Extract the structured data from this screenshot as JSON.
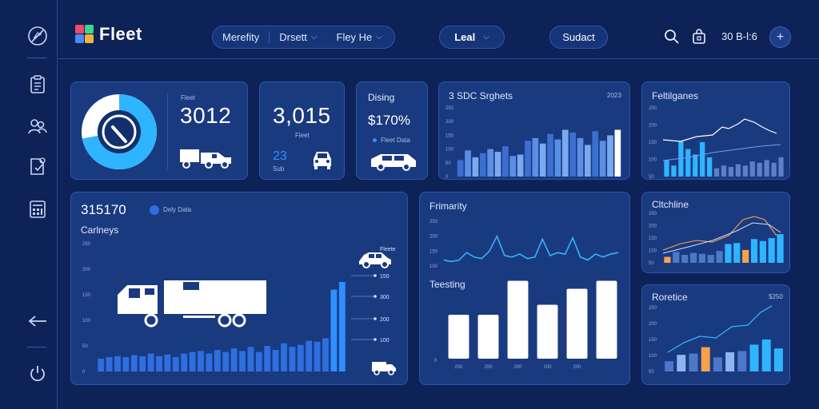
{
  "app": {
    "name": "Fleet",
    "nav": [
      {
        "label": "Merefity"
      },
      {
        "label": "Drsett"
      },
      {
        "label": "Fley He"
      }
    ],
    "filter": {
      "label": "Leal"
    },
    "action": {
      "label": "Sudact"
    },
    "status_text": "30 B-l:6",
    "icons": {
      "sidebar": [
        "compass-icon",
        "clipboard-icon",
        "users-icon",
        "document-icon",
        "calculator-icon",
        "arrow-left-icon",
        "power-icon"
      ],
      "top": [
        "search-icon",
        "bag-icon",
        "plus-icon"
      ]
    },
    "colors": {
      "accent": "#2fb4ff",
      "bar": "#2e8ff0",
      "orange": "#f6a24a"
    }
  },
  "kpi_gauge": {
    "label": "Fleet",
    "value": "3012",
    "gauge_fraction": 0.72
  },
  "kpi_count": {
    "value": "3,015",
    "sub_label": "Fleet",
    "small_value": "23",
    "small_label": "Sub"
  },
  "kpi_rate": {
    "title": "Dising",
    "value": "$170%",
    "legend": "Fleet Data"
  },
  "card_segments": {
    "title": "3 SDC Srghets",
    "corner": "2023",
    "yticks": [
      "250",
      "200",
      "150",
      "100",
      "50",
      "0"
    ]
  },
  "card_fellagenes": {
    "title": "Feltilganes",
    "yticks": [
      "250",
      "200",
      "150",
      "100",
      "50"
    ]
  },
  "card_main": {
    "value": "315170",
    "legend": "Dely Data",
    "subtitle": "Carlneys",
    "yticks": [
      "250",
      "200",
      "150",
      "100",
      "50",
      "0"
    ],
    "right_values": [
      "Fleete",
      "150",
      "300",
      "200",
      "100"
    ]
  },
  "card_frimarity": {
    "title": "Frimarity",
    "yticks": [
      "250",
      "200",
      "150",
      "100"
    ],
    "subtitle": "Teesting",
    "xticks": [
      "200",
      "200",
      "200",
      "200",
      "200"
    ]
  },
  "card_clitchline": {
    "title": "Cltchline",
    "yticks": [
      "250",
      "200",
      "150",
      "100",
      "50"
    ]
  },
  "card_roretice": {
    "title": "Roretice",
    "corner": "$250",
    "yticks": [
      "250",
      "200",
      "150",
      "100",
      "50"
    ]
  },
  "chart_data": [
    {
      "type": "bar",
      "title": "3 SDC Srghets",
      "series": [
        {
          "values": [
            60,
            95,
            70,
            85,
            100,
            90,
            110,
            75,
            80,
            130,
            140,
            120,
            155,
            135,
            170,
            160,
            140,
            115,
            165,
            130,
            150,
            170
          ]
        }
      ],
      "ylim": [
        0,
        250
      ]
    },
    {
      "type": "bar",
      "title": "Feltilganes",
      "series": [
        {
          "values": [
            60,
            40,
            130,
            100,
            80,
            125,
            70,
            30,
            40,
            35,
            45,
            40,
            55,
            50,
            60,
            50,
            70
          ]
        }
      ],
      "ylim": [
        0,
        250
      ]
    },
    {
      "type": "bar",
      "title": "Carlneys",
      "series": [
        {
          "values": [
            25,
            28,
            30,
            28,
            32,
            30,
            35,
            30,
            33,
            28,
            35,
            38,
            40,
            35,
            42,
            38,
            45,
            40,
            48,
            38,
            50,
            42,
            55,
            48,
            52,
            60,
            58,
            65,
            160,
            175
          ]
        }
      ],
      "ylim": [
        0,
        250
      ]
    },
    {
      "type": "line",
      "title": "Frimarity",
      "series": [
        {
          "values": [
            120,
            115,
            120,
            145,
            130,
            125,
            150,
            200,
            135,
            130,
            140,
            125,
            130,
            190,
            135,
            145,
            140,
            195,
            130,
            120,
            140,
            130,
            140,
            145
          ]
        }
      ],
      "ylim": [
        100,
        250
      ]
    },
    {
      "type": "bar",
      "title": "Teesting",
      "series": [
        {
          "values": [
            110,
            110,
            195,
            135,
            175,
            195
          ]
        }
      ],
      "ylim": [
        0,
        200
      ]
    },
    {
      "type": "bar",
      "title": "Cltchline",
      "series": [
        {
          "values": [
            30,
            55,
            40,
            50,
            45,
            40,
            60,
            95,
            100,
            65,
            120,
            110,
            125,
            145
          ]
        }
      ],
      "ylim": [
        0,
        250
      ]
    },
    {
      "type": "bar",
      "title": "Roretice",
      "series": [
        {
          "values": [
            40,
            65,
            70,
            95,
            55,
            75,
            80,
            105,
            125,
            90
          ]
        }
      ],
      "ylim": [
        0,
        250
      ]
    }
  ]
}
